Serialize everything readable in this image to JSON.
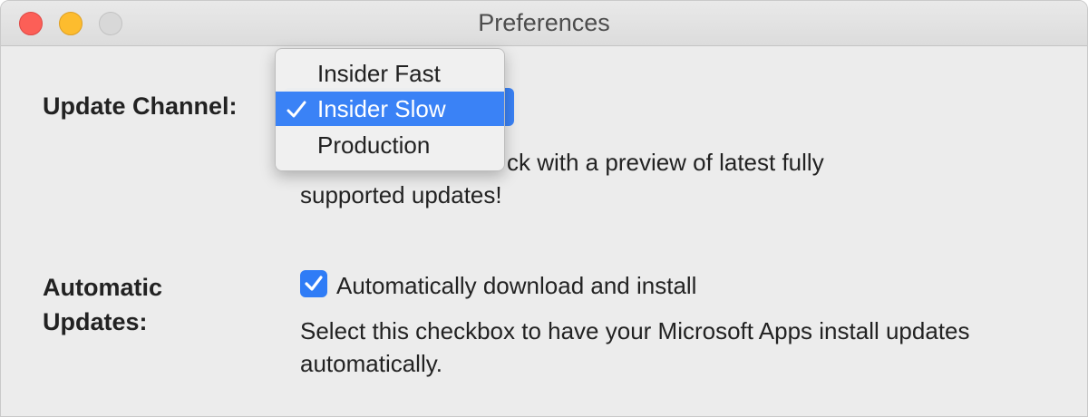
{
  "window": {
    "title": "Preferences"
  },
  "update_channel": {
    "label": "Update Channel:",
    "options": [
      {
        "label": "Insider Fast",
        "selected": false
      },
      {
        "label": "Insider Slow",
        "selected": true
      },
      {
        "label": "Production",
        "selected": false
      }
    ],
    "description_line1": "ck with a preview of latest fully",
    "description_line2": "supported updates!"
  },
  "automatic_updates": {
    "label_line1": "Automatic",
    "label_line2": "Updates:",
    "checkbox_label": "Automatically download and install",
    "checked": true,
    "help_line1": "Select this checkbox to have your Microsoft Apps install updates",
    "help_line2": "automatically."
  },
  "colors": {
    "accent": "#3a82f6",
    "close": "#fc5f57",
    "minimize": "#fdbc2e",
    "zoom_disabled": "#d8d8d8"
  },
  "icons": {
    "close": "close-icon",
    "minimize": "minimize-icon",
    "zoom": "zoom-icon",
    "checkmark": "checkmark-icon"
  }
}
